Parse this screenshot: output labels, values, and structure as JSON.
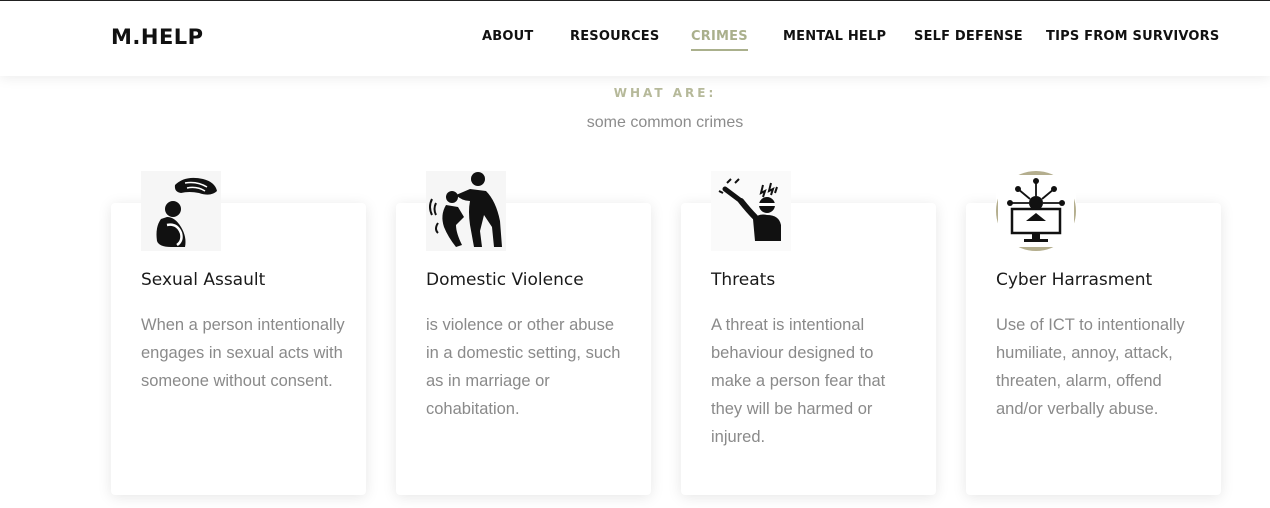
{
  "brand": {
    "logo": "M.HELP"
  },
  "nav": {
    "items": [
      {
        "label": "ABOUT",
        "active": false
      },
      {
        "label": "RESOURCES",
        "active": false
      },
      {
        "label": "CRIMES",
        "active": true
      },
      {
        "label": "MENTAL HELP",
        "active": false
      },
      {
        "label": "SELF DEFENSE",
        "active": false
      },
      {
        "label": "TIPS FROM SURVIVORS",
        "active": false
      }
    ]
  },
  "section": {
    "label": "WHAT ARE:",
    "subtitle": "some common crimes"
  },
  "cards": [
    {
      "icon": "sexual-assault-icon",
      "title": "Sexual Assault",
      "text": "When a person intentionally engages in sexual acts with someone without consent."
    },
    {
      "icon": "domestic-violence-icon",
      "title": "Domestic Violence",
      "text": "is violence or other abuse in a domestic setting, such as in marriage or cohabitation."
    },
    {
      "icon": "threats-icon",
      "title": "Threats",
      "text": "A threat is intentional behaviour designed to make a person fear that they will be harmed or injured."
    },
    {
      "icon": "cyber-harassment-icon",
      "title": "Cyber Harrasment",
      "text": "Use of ICT to intentionally humiliate, annoy, attack, threaten, alarm, offend and/or verbally abuse."
    }
  ],
  "colors": {
    "accent": "#aab08c",
    "body_text": "#8a8a8a",
    "heading": "#1a1a1a"
  }
}
